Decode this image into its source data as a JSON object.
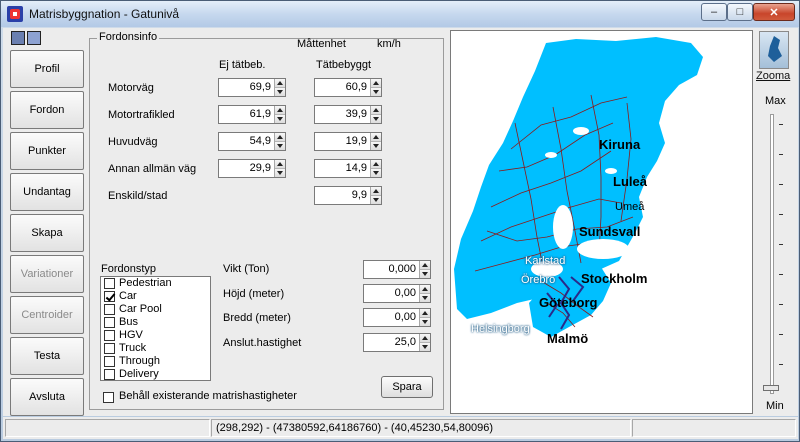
{
  "window": {
    "title": "Matrisbyggnation - Gatunivå",
    "controls": {
      "minimize": "–",
      "maximize": "□",
      "close": "✕"
    }
  },
  "nav": {
    "items": [
      {
        "label": "Profil",
        "enabled": true
      },
      {
        "label": "Fordon",
        "enabled": true
      },
      {
        "label": "Punkter",
        "enabled": true
      },
      {
        "label": "Undantag",
        "enabled": true
      },
      {
        "label": "Skapa",
        "enabled": true
      },
      {
        "label": "Variationer",
        "enabled": false
      },
      {
        "label": "Centroider",
        "enabled": false
      },
      {
        "label": "Testa",
        "enabled": true
      },
      {
        "label": "Avsluta",
        "enabled": true
      }
    ]
  },
  "fordonsinfo": {
    "legend": "Fordonsinfo",
    "unit_label": "Måttenhet",
    "unit_value": "km/h",
    "col_outside": "Ej tätbeb.",
    "col_inside": "Tätbebyggt",
    "rows": [
      {
        "label": "Motorväg",
        "outside": "69,9",
        "inside": "60,9"
      },
      {
        "label": "Motortrafikled",
        "outside": "61,9",
        "inside": "39,9"
      },
      {
        "label": "Huvudväg",
        "outside": "54,9",
        "inside": "19,9"
      },
      {
        "label": "Annan allmän väg",
        "outside": "29,9",
        "inside": "14,9"
      },
      {
        "label": "Enskild/stad",
        "outside": null,
        "inside": "9,9"
      }
    ]
  },
  "fordonstyp": {
    "label": "Fordonstyp",
    "items": [
      {
        "label": "Pedestrian",
        "checked": false
      },
      {
        "label": "Car",
        "checked": true
      },
      {
        "label": "Car Pool",
        "checked": false
      },
      {
        "label": "Bus",
        "checked": false
      },
      {
        "label": "HGV",
        "checked": false
      },
      {
        "label": "Truck",
        "checked": false
      },
      {
        "label": "Through",
        "checked": false
      },
      {
        "label": "Delivery",
        "checked": false
      }
    ]
  },
  "params": {
    "rows": [
      {
        "label": "Vikt (Ton)",
        "value": "0,000"
      },
      {
        "label": "Höjd (meter)",
        "value": "0,00"
      },
      {
        "label": "Bredd (meter)",
        "value": "0,00"
      },
      {
        "label": "Anslut.hastighet",
        "value": "25,0"
      }
    ]
  },
  "keep_existing": {
    "label": "Behåll existerande matrishastigheter",
    "checked": false
  },
  "save_label": "Spara",
  "map": {
    "cities": {
      "kiruna": "Kiruna",
      "lulea": "Luleå",
      "umea": "Umeå",
      "sundsvall": "Sundsvall",
      "karlstad": "Karlstad",
      "orebro": "Örebro",
      "stockholm": "Stockholm",
      "goteborg": "Göteborg",
      "helsingborg": "Helsingborg",
      "malmo": "Malmö"
    },
    "colors": {
      "land": "#00bfff",
      "roads": "#8b1a1a",
      "water": "#ffffff"
    }
  },
  "zoom": {
    "label": "Zooma",
    "max_label": "Max",
    "min_label": "Min",
    "level": 0.0,
    "icon": "map-zoom-icon"
  },
  "status": {
    "cursor": "(298,292)",
    "coords": "(47380592,64186760) - (40,45230,54,80096)"
  }
}
